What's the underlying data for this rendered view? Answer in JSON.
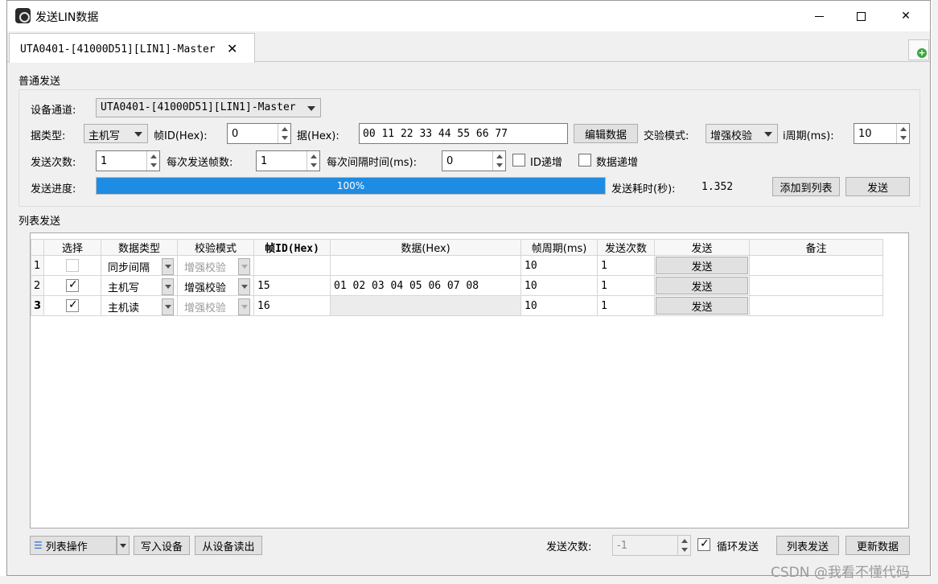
{
  "window": {
    "title": "发送LIN数据"
  },
  "tab": {
    "label": "UTA0401-[41000D51][LIN1]-Master",
    "close": "✕"
  },
  "normal_send": {
    "section_title": "普通发送",
    "device_channel_label": "设备通道:",
    "device_channel_value": "UTA0401-[41000D51][LIN1]-Master",
    "data_type_label": "据类型:",
    "data_type_value": "主机写",
    "frame_id_label": "帧ID(Hex):",
    "frame_id_value": "0",
    "data_hex_label": "据(Hex):",
    "data_hex_value": "00 11 22 33 44 55 66 77",
    "edit_data_button": "编辑数据",
    "checksum_label": "交验模式:",
    "checksum_value": "增强校验",
    "period_label": "i周期(ms):",
    "period_value": "10",
    "send_count_label": "发送次数:",
    "send_count_value": "1",
    "frames_per_send_label": "每次发送帧数:",
    "frames_per_send_value": "1",
    "interval_label": "每次间隔时间(ms):",
    "interval_value": "0",
    "id_increment_label": "ID递增",
    "data_increment_label": "数据递增",
    "progress_label": "发送进度:",
    "progress_percent": 100,
    "progress_text": "100%",
    "elapsed_label": "发送耗时(秒):",
    "elapsed_value": "1.352",
    "add_to_list_button": "添加到列表",
    "send_button": "发送"
  },
  "list_send": {
    "section_title": "列表发送",
    "columns": [
      "选择",
      "数据类型",
      "校验模式",
      "帧ID(Hex)",
      "数据(Hex)",
      "帧周期(ms)",
      "发送次数",
      "发送",
      "备注"
    ],
    "rows": [
      {
        "num": "1",
        "checked": false,
        "type": "同步间隔",
        "checksum": "增强校验",
        "frame_id": "",
        "data": "",
        "period": "10",
        "count": "1",
        "send": "发送",
        "note": ""
      },
      {
        "num": "2",
        "checked": true,
        "type": "主机写",
        "checksum": "增强校验",
        "frame_id": "15",
        "data": "01 02 03 04 05 06 07 08",
        "period": "10",
        "count": "1",
        "send": "发送",
        "note": ""
      },
      {
        "num": "3",
        "checked": true,
        "type": "主机读",
        "checksum": "增强校验",
        "frame_id": "16",
        "data": "",
        "period": "10",
        "count": "1",
        "send": "发送",
        "note": ""
      }
    ]
  },
  "bottom": {
    "list_ops_button": "列表操作",
    "write_device_button": "写入设备",
    "read_device_button": "从设备读出",
    "send_count_label": "发送次数:",
    "send_count_value": "-1",
    "loop_send_label": "循环发送",
    "list_send_button": "列表发送",
    "update_data_button": "更新数据"
  },
  "watermark": "CSDN @我看不懂代码"
}
